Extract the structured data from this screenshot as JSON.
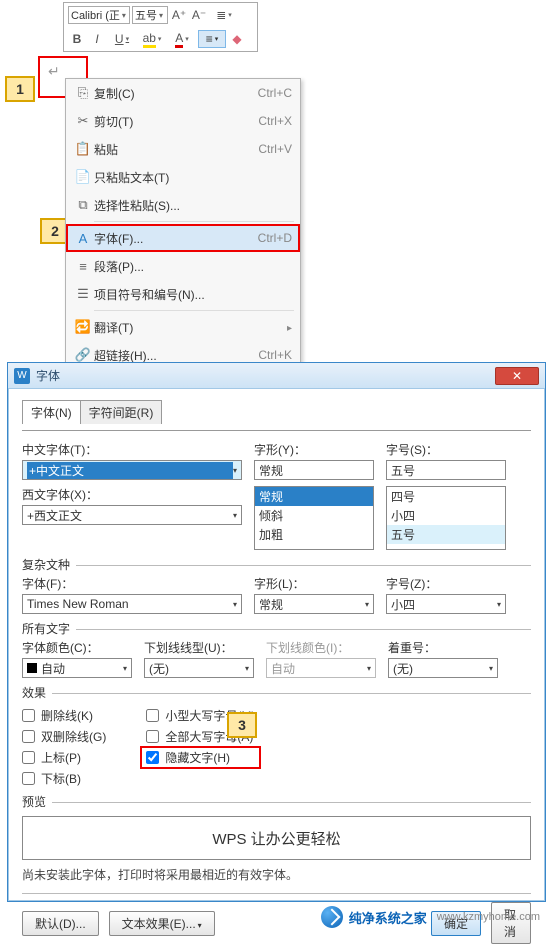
{
  "toolbar": {
    "font_name": "Calibri (正",
    "font_size": "五号",
    "inc_font": "A⁺",
    "dec_font": "A⁻",
    "bold": "B",
    "italic": "I",
    "underline": "U",
    "strikethrough": "A",
    "font_color": "A"
  },
  "context_menu": {
    "copy": {
      "label": "复制(C)",
      "shortcut": "Ctrl+C"
    },
    "cut": {
      "label": "剪切(T)",
      "shortcut": "Ctrl+X"
    },
    "paste": {
      "label": "粘贴",
      "shortcut": "Ctrl+V"
    },
    "paste_text": {
      "label": "只粘贴文本(T)"
    },
    "paste_special": {
      "label": "选择性粘贴(S)..."
    },
    "font": {
      "label": "字体(F)...",
      "shortcut": "Ctrl+D"
    },
    "paragraph": {
      "label": "段落(P)..."
    },
    "bullets": {
      "label": "项目符号和编号(N)..."
    },
    "translate": {
      "label": "翻译(T)"
    },
    "hyperlink": {
      "label": "超链接(H)...",
      "shortcut": "Ctrl+K"
    }
  },
  "dialog": {
    "title": "字体",
    "close": "✕",
    "tabs": {
      "font": "字体(N)",
      "spacing": "字符间距(R)"
    },
    "cn_font_label": "中文字体(T)：",
    "cn_font_value": "+中文正文",
    "style_label": "字形(Y)：",
    "style_value": "常规",
    "style_options": [
      "常规",
      "倾斜",
      "加粗"
    ],
    "size_label": "字号(S)：",
    "size_value": "五号",
    "size_options": [
      "四号",
      "小四",
      "五号"
    ],
    "en_font_label": "西文字体(X)：",
    "en_font_value": "+西文正文",
    "complex_title": "复杂文种",
    "complex_font_label": "字体(F)：",
    "complex_font_value": "Times New Roman",
    "complex_style_label": "字形(L)：",
    "complex_style_value": "常规",
    "complex_size_label": "字号(Z)：",
    "complex_size_value": "小四",
    "all_text_title": "所有文字",
    "font_color_label": "字体颜色(C)：",
    "font_color_value": "自动",
    "underline_label": "下划线线型(U)：",
    "underline_value": "(无)",
    "underline_color_label": "下划线颜色(I)：",
    "underline_color_value": "自动",
    "emphasis_label": "着重号：",
    "emphasis_value": "(无)",
    "effects_title": "效果",
    "fx": {
      "strike": "删除线(K)",
      "dblstrike": "双删除线(G)",
      "superscript": "上标(P)",
      "subscript": "下标(B)",
      "smallcaps": "小型大写字母(M)",
      "allcaps": "全部大写字母(A)",
      "hidden": "隐藏文字(H)"
    },
    "preview_title": "预览",
    "preview_text": "WPS 让办公更轻松",
    "note": "尚未安装此字体，打印时将采用最相近的有效字体。",
    "default_btn": "默认(D)...",
    "text_effect_btn": "文本效果(E)...",
    "ok_btn": "确定",
    "cancel_btn": "取消"
  },
  "watermark": {
    "brand": "纯净系统之家",
    "url": "www.kzmyhome.com"
  },
  "badges": {
    "b1": "1",
    "b2": "2",
    "b3": "3"
  }
}
